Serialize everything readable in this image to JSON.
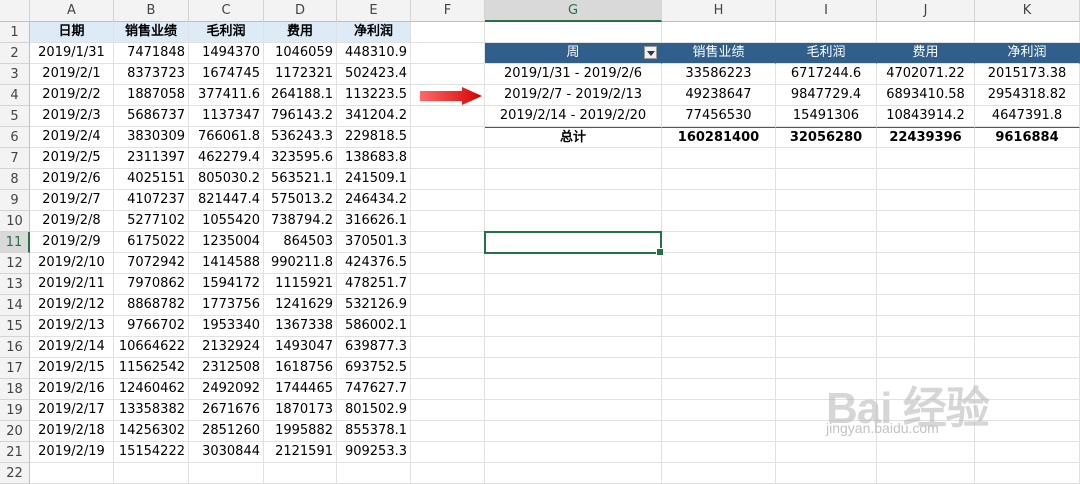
{
  "columns": [
    "A",
    "B",
    "C",
    "D",
    "E",
    "F",
    "G",
    "H",
    "I",
    "J",
    "K"
  ],
  "rows": [
    "1",
    "2",
    "3",
    "4",
    "5",
    "6",
    "7",
    "8",
    "9",
    "10",
    "11",
    "12",
    "13",
    "14",
    "15",
    "16",
    "17",
    "18",
    "19",
    "20",
    "21",
    "22"
  ],
  "source_headers": [
    "日期",
    "销售业绩",
    "毛利润",
    "费用",
    "净利润"
  ],
  "source_data": [
    [
      "2019/1/31",
      "7471848",
      "1494370",
      "1046059",
      "448310.9"
    ],
    [
      "2019/2/1",
      "8373723",
      "1674745",
      "1172321",
      "502423.4"
    ],
    [
      "2019/2/2",
      "1887058",
      "377411.6",
      "264188.1",
      "113223.5"
    ],
    [
      "2019/2/3",
      "5686737",
      "1137347",
      "796143.2",
      "341204.2"
    ],
    [
      "2019/2/4",
      "3830309",
      "766061.8",
      "536243.3",
      "229818.5"
    ],
    [
      "2019/2/5",
      "2311397",
      "462279.4",
      "323595.6",
      "138683.8"
    ],
    [
      "2019/2/6",
      "4025151",
      "805030.2",
      "563521.1",
      "241509.1"
    ],
    [
      "2019/2/7",
      "4107237",
      "821447.4",
      "575013.2",
      "246434.2"
    ],
    [
      "2019/2/8",
      "5277102",
      "1055420",
      "738794.2",
      "316626.1"
    ],
    [
      "2019/2/9",
      "6175022",
      "1235004",
      "864503",
      "370501.3"
    ],
    [
      "2019/2/10",
      "7072942",
      "1414588",
      "990211.8",
      "424376.5"
    ],
    [
      "2019/2/11",
      "7970862",
      "1594172",
      "1115921",
      "478251.7"
    ],
    [
      "2019/2/12",
      "8868782",
      "1773756",
      "1241629",
      "532126.9"
    ],
    [
      "2019/2/13",
      "9766702",
      "1953340",
      "1367338",
      "586002.1"
    ],
    [
      "2019/2/14",
      "10664622",
      "2132924",
      "1493047",
      "639877.3"
    ],
    [
      "2019/2/15",
      "11562542",
      "2312508",
      "1618756",
      "693752.5"
    ],
    [
      "2019/2/16",
      "12460462",
      "2492092",
      "1744465",
      "747627.7"
    ],
    [
      "2019/2/17",
      "13358382",
      "2671676",
      "1870173",
      "801502.9"
    ],
    [
      "2019/2/18",
      "14256302",
      "2851260",
      "1995882",
      "855378.1"
    ],
    [
      "2019/2/19",
      "15154222",
      "3030844",
      "2121591",
      "909253.3"
    ]
  ],
  "pivot": {
    "headers": [
      "周",
      "销售业绩",
      "毛利润",
      "费用",
      "净利润"
    ],
    "rows": [
      [
        "2019/1/31 - 2019/2/6",
        "33586223",
        "6717244.6",
        "4702071.22",
        "2015173.38"
      ],
      [
        "2019/2/7 - 2019/2/13",
        "49238647",
        "9847729.4",
        "6893410.58",
        "2954318.82"
      ],
      [
        "2019/2/14 - 2019/2/20",
        "77456530",
        "15491306",
        "10843914.2",
        "4647391.8"
      ]
    ],
    "total": [
      "总计",
      "160281400",
      "32056280",
      "22439396",
      "9616884"
    ]
  },
  "selected_cell": "G11",
  "colors": {
    "pivot_header": "#2f5f8a",
    "source_header": "#ddebf7",
    "selection": "#217346",
    "arrow": "#e02020"
  },
  "watermark": {
    "main": "Bai 经验",
    "sub": "jingyan.baidu.com"
  }
}
